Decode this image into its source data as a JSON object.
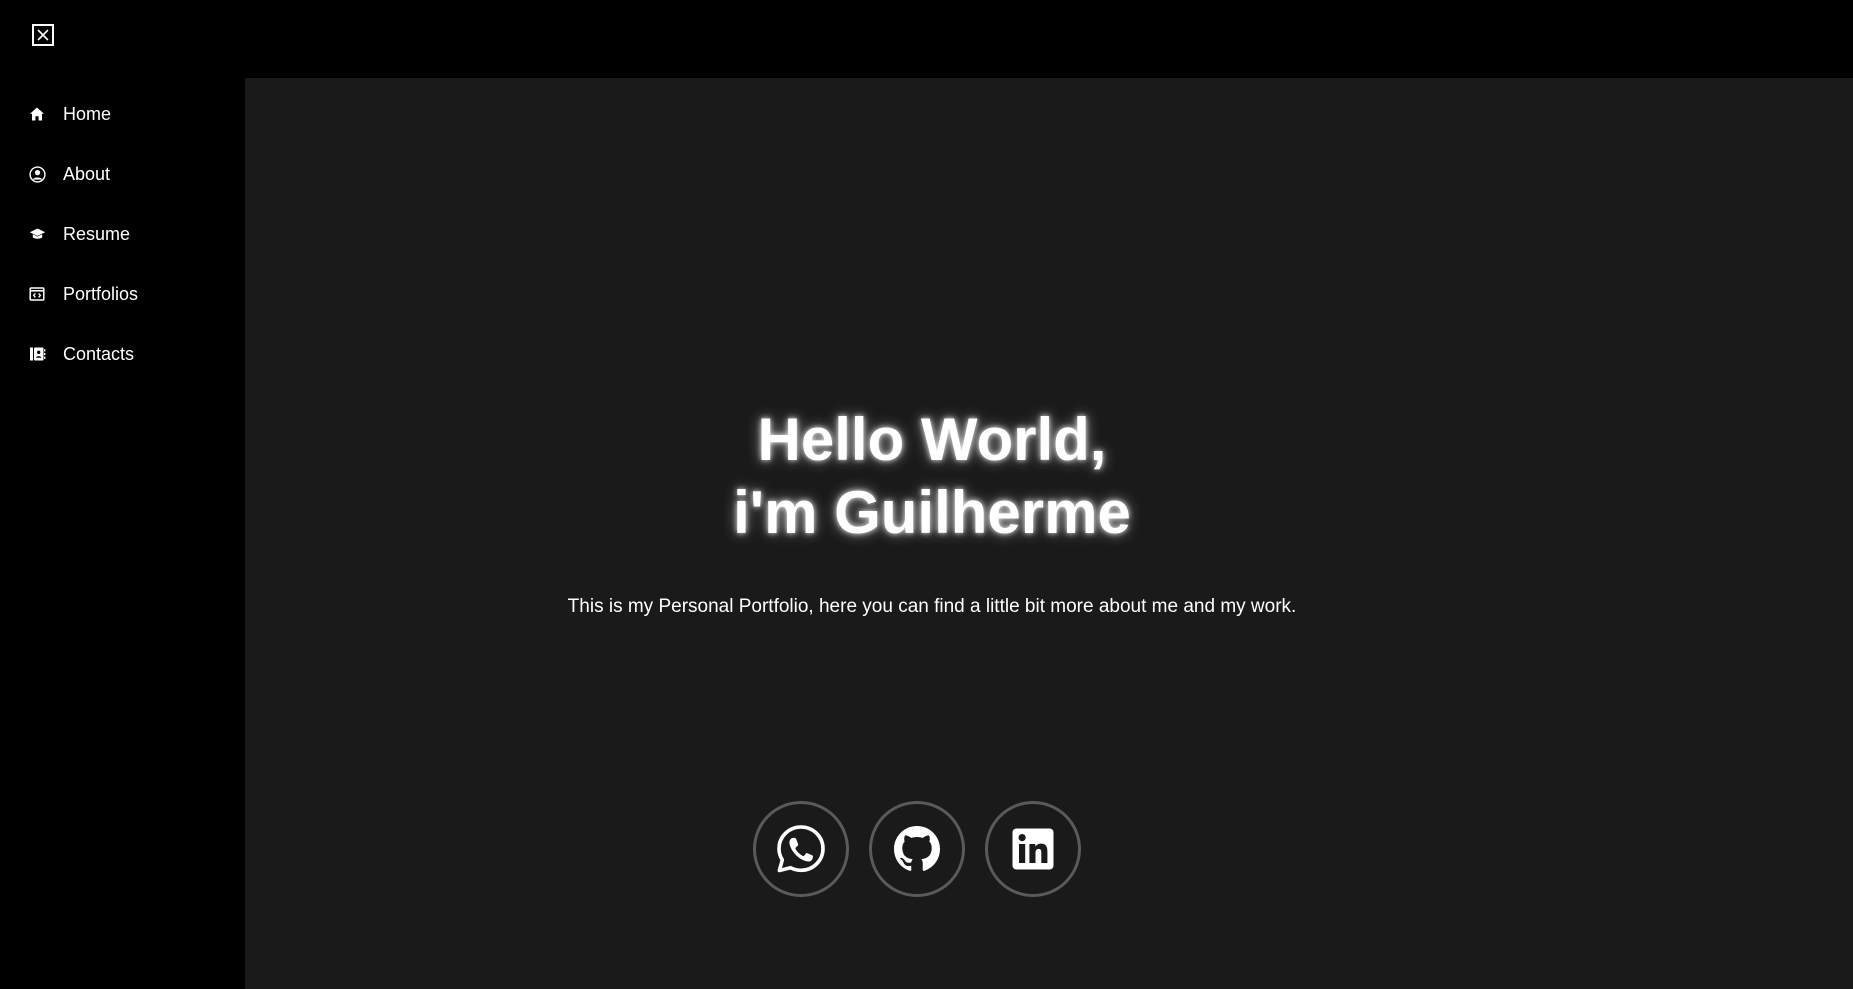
{
  "sidebar": {
    "close_icon": "close-icon",
    "items": [
      {
        "label": "Home",
        "icon": "home-icon"
      },
      {
        "label": "About",
        "icon": "user-circle-icon"
      },
      {
        "label": "Resume",
        "icon": "graduation-cap-icon"
      },
      {
        "label": "Portfolios",
        "icon": "code-window-icon"
      },
      {
        "label": "Contacts",
        "icon": "contacts-book-icon"
      }
    ]
  },
  "hero": {
    "title_line1": "Hello World,",
    "title_line2": "i'm Guilherme",
    "subtitle": "This is my Personal Portfolio, here you can find a little bit more about me and my work."
  },
  "socials": [
    {
      "icon": "whatsapp-icon"
    },
    {
      "icon": "github-icon"
    },
    {
      "icon": "linkedin-icon"
    }
  ],
  "colors": {
    "sidebar_bg": "#000000",
    "main_bg": "#1a1a1a",
    "text": "#ffffff",
    "social_border": "#5a5a5a"
  }
}
